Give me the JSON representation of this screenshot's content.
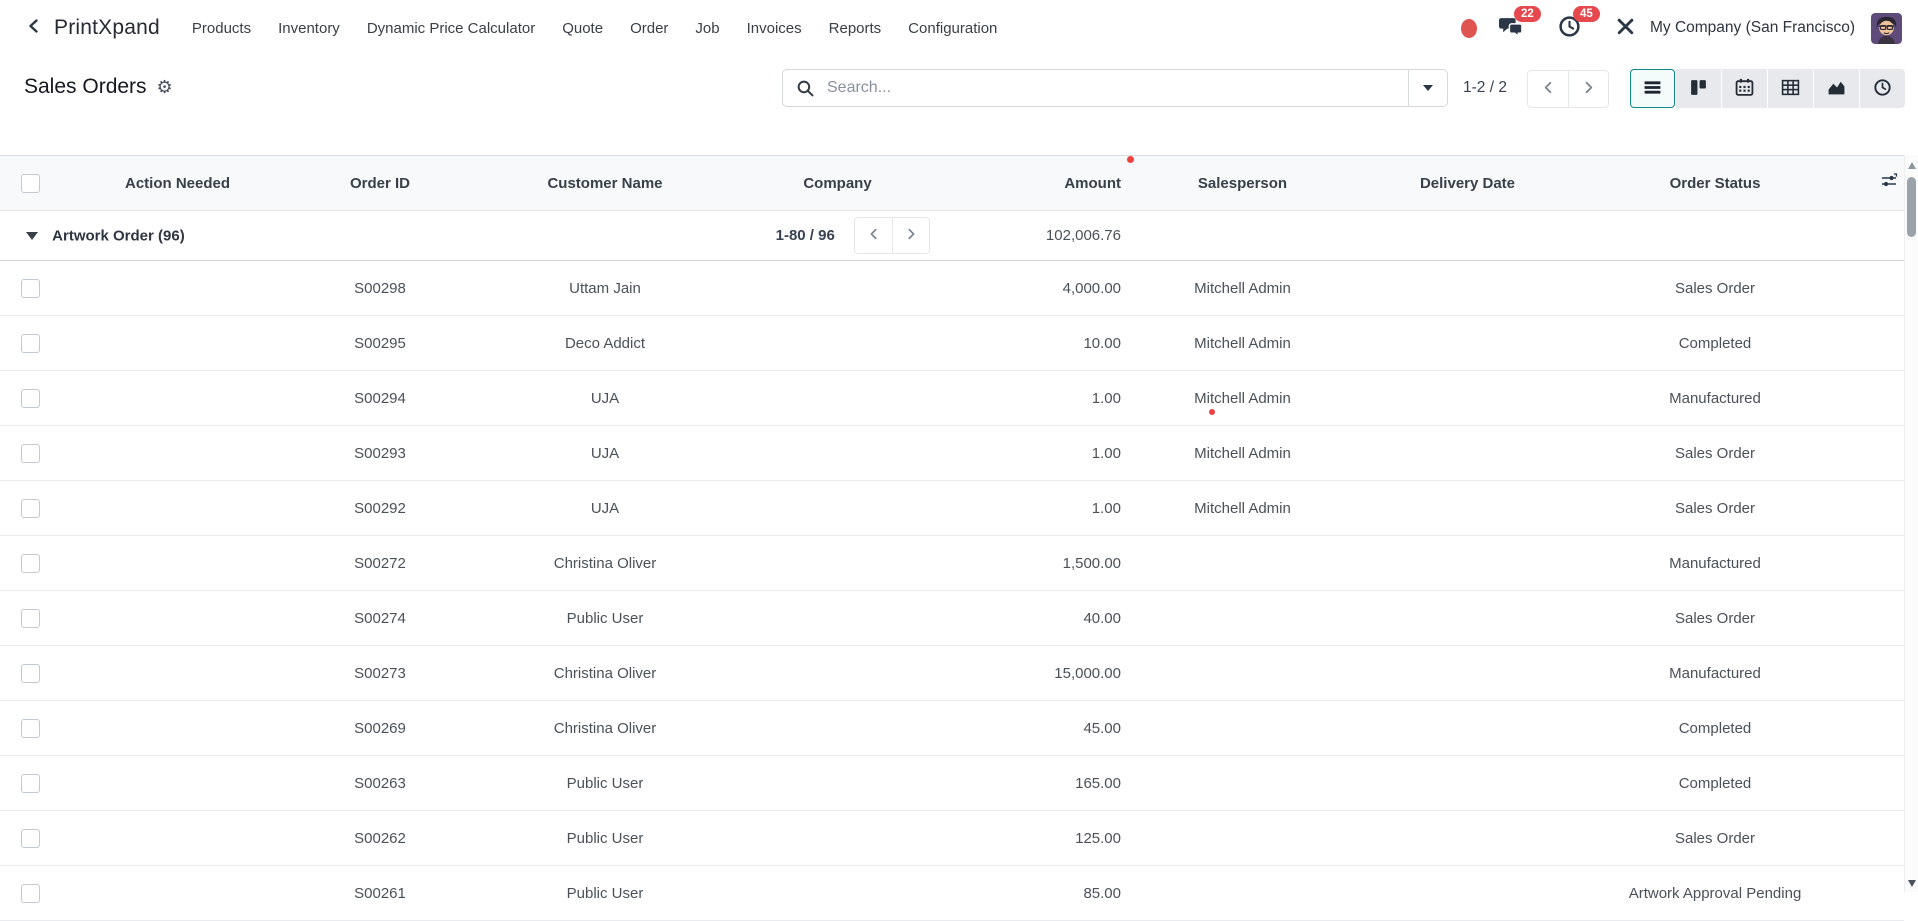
{
  "navbar": {
    "brand": "PrintXpand",
    "menus": [
      "Products",
      "Inventory",
      "Dynamic Price Calculator",
      "Quote",
      "Order",
      "Job",
      "Invoices",
      "Reports",
      "Configuration"
    ],
    "messages_badge": "22",
    "activities_badge": "45",
    "company": "My Company (San Francisco)"
  },
  "control_panel": {
    "title": "Sales Orders",
    "search_placeholder": "Search...",
    "pager_text": "1-2 / 2",
    "view_switcher": [
      {
        "name": "list",
        "active": true
      },
      {
        "name": "kanban",
        "active": false
      },
      {
        "name": "calendar",
        "active": false
      },
      {
        "name": "pivot",
        "active": false
      },
      {
        "name": "graph",
        "active": false
      },
      {
        "name": "activity",
        "active": false
      }
    ]
  },
  "table": {
    "columns": [
      "Action Needed",
      "Order ID",
      "Customer Name",
      "Company",
      "Amount",
      "Salesperson",
      "Delivery Date",
      "Order Status"
    ],
    "group": {
      "label": "Artwork Order (96)",
      "pager": "1-80 / 96",
      "amount_sum": "102,006.76"
    },
    "rows": [
      {
        "order_id": "S00298",
        "customer": "Uttam Jain",
        "amount": "4,000.00",
        "salesperson": "Mitchell Admin",
        "status": "Sales Order"
      },
      {
        "order_id": "S00295",
        "customer": "Deco Addict",
        "amount": "10.00",
        "salesperson": "Mitchell Admin",
        "status": "Completed"
      },
      {
        "order_id": "S00294",
        "customer": "UJA",
        "amount": "1.00",
        "salesperson": "Mitchell Admin",
        "status": "Manufactured"
      },
      {
        "order_id": "S00293",
        "customer": "UJA",
        "amount": "1.00",
        "salesperson": "Mitchell Admin",
        "status": "Sales Order"
      },
      {
        "order_id": "S00292",
        "customer": "UJA",
        "amount": "1.00",
        "salesperson": "Mitchell Admin",
        "status": "Sales Order"
      },
      {
        "order_id": "S00272",
        "customer": "Christina Oliver",
        "amount": "1,500.00",
        "salesperson": "",
        "status": "Manufactured"
      },
      {
        "order_id": "S00274",
        "customer": "Public User",
        "amount": "40.00",
        "salesperson": "",
        "status": "Sales Order"
      },
      {
        "order_id": "S00273",
        "customer": "Christina Oliver",
        "amount": "15,000.00",
        "salesperson": "",
        "status": "Manufactured"
      },
      {
        "order_id": "S00269",
        "customer": "Christina Oliver",
        "amount": "45.00",
        "salesperson": "",
        "status": "Completed"
      },
      {
        "order_id": "S00263",
        "customer": "Public User",
        "amount": "165.00",
        "salesperson": "",
        "status": "Completed"
      },
      {
        "order_id": "S00262",
        "customer": "Public User",
        "amount": "125.00",
        "salesperson": "",
        "status": "Sales Order"
      },
      {
        "order_id": "S00261",
        "customer": "Public User",
        "amount": "85.00",
        "salesperson": "",
        "status": "Artwork Approval Pending"
      }
    ]
  },
  "icons": {
    "back": "chevron-left",
    "title_settings": "gear",
    "search": "magnifier",
    "search_expand": "caret-down",
    "messages": "chat-bubbles",
    "activities": "clock",
    "user_tools": "crossed-tools",
    "views": [
      "list",
      "kanban",
      "calendar",
      "pivot",
      "graph",
      "activity"
    ],
    "optional_columns": "sliders",
    "group_caret": "caret-down"
  },
  "colors": {
    "accent": "#017e84",
    "badge_red": "#e5484d",
    "annotation_dot": "#ef4040"
  }
}
